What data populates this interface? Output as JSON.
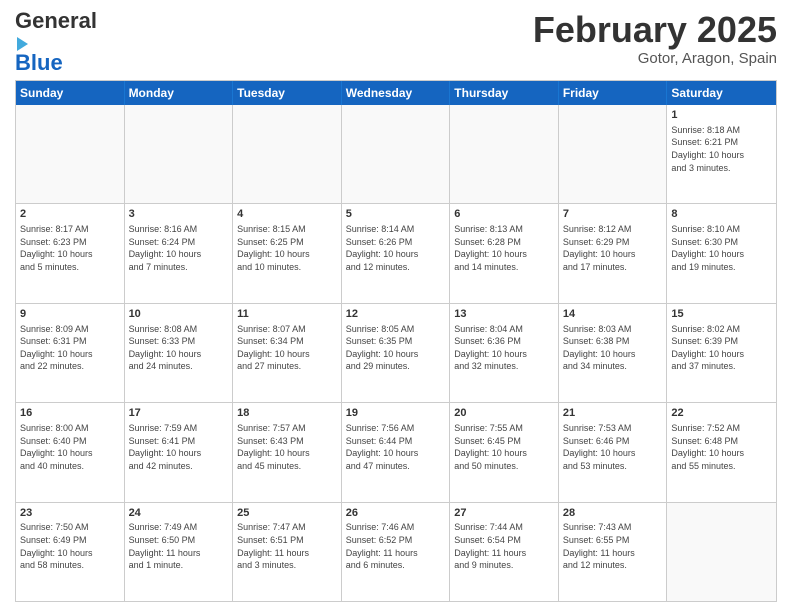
{
  "logo": {
    "line1": "General",
    "line2": "Blue"
  },
  "title": "February 2025",
  "subtitle": "Gotor, Aragon, Spain",
  "weekdays": [
    "Sunday",
    "Monday",
    "Tuesday",
    "Wednesday",
    "Thursday",
    "Friday",
    "Saturday"
  ],
  "rows": [
    [
      {
        "day": "",
        "info": ""
      },
      {
        "day": "",
        "info": ""
      },
      {
        "day": "",
        "info": ""
      },
      {
        "day": "",
        "info": ""
      },
      {
        "day": "",
        "info": ""
      },
      {
        "day": "",
        "info": ""
      },
      {
        "day": "1",
        "info": "Sunrise: 8:18 AM\nSunset: 6:21 PM\nDaylight: 10 hours\nand 3 minutes."
      }
    ],
    [
      {
        "day": "2",
        "info": "Sunrise: 8:17 AM\nSunset: 6:23 PM\nDaylight: 10 hours\nand 5 minutes."
      },
      {
        "day": "3",
        "info": "Sunrise: 8:16 AM\nSunset: 6:24 PM\nDaylight: 10 hours\nand 7 minutes."
      },
      {
        "day": "4",
        "info": "Sunrise: 8:15 AM\nSunset: 6:25 PM\nDaylight: 10 hours\nand 10 minutes."
      },
      {
        "day": "5",
        "info": "Sunrise: 8:14 AM\nSunset: 6:26 PM\nDaylight: 10 hours\nand 12 minutes."
      },
      {
        "day": "6",
        "info": "Sunrise: 8:13 AM\nSunset: 6:28 PM\nDaylight: 10 hours\nand 14 minutes."
      },
      {
        "day": "7",
        "info": "Sunrise: 8:12 AM\nSunset: 6:29 PM\nDaylight: 10 hours\nand 17 minutes."
      },
      {
        "day": "8",
        "info": "Sunrise: 8:10 AM\nSunset: 6:30 PM\nDaylight: 10 hours\nand 19 minutes."
      }
    ],
    [
      {
        "day": "9",
        "info": "Sunrise: 8:09 AM\nSunset: 6:31 PM\nDaylight: 10 hours\nand 22 minutes."
      },
      {
        "day": "10",
        "info": "Sunrise: 8:08 AM\nSunset: 6:33 PM\nDaylight: 10 hours\nand 24 minutes."
      },
      {
        "day": "11",
        "info": "Sunrise: 8:07 AM\nSunset: 6:34 PM\nDaylight: 10 hours\nand 27 minutes."
      },
      {
        "day": "12",
        "info": "Sunrise: 8:05 AM\nSunset: 6:35 PM\nDaylight: 10 hours\nand 29 minutes."
      },
      {
        "day": "13",
        "info": "Sunrise: 8:04 AM\nSunset: 6:36 PM\nDaylight: 10 hours\nand 32 minutes."
      },
      {
        "day": "14",
        "info": "Sunrise: 8:03 AM\nSunset: 6:38 PM\nDaylight: 10 hours\nand 34 minutes."
      },
      {
        "day": "15",
        "info": "Sunrise: 8:02 AM\nSunset: 6:39 PM\nDaylight: 10 hours\nand 37 minutes."
      }
    ],
    [
      {
        "day": "16",
        "info": "Sunrise: 8:00 AM\nSunset: 6:40 PM\nDaylight: 10 hours\nand 40 minutes."
      },
      {
        "day": "17",
        "info": "Sunrise: 7:59 AM\nSunset: 6:41 PM\nDaylight: 10 hours\nand 42 minutes."
      },
      {
        "day": "18",
        "info": "Sunrise: 7:57 AM\nSunset: 6:43 PM\nDaylight: 10 hours\nand 45 minutes."
      },
      {
        "day": "19",
        "info": "Sunrise: 7:56 AM\nSunset: 6:44 PM\nDaylight: 10 hours\nand 47 minutes."
      },
      {
        "day": "20",
        "info": "Sunrise: 7:55 AM\nSunset: 6:45 PM\nDaylight: 10 hours\nand 50 minutes."
      },
      {
        "day": "21",
        "info": "Sunrise: 7:53 AM\nSunset: 6:46 PM\nDaylight: 10 hours\nand 53 minutes."
      },
      {
        "day": "22",
        "info": "Sunrise: 7:52 AM\nSunset: 6:48 PM\nDaylight: 10 hours\nand 55 minutes."
      }
    ],
    [
      {
        "day": "23",
        "info": "Sunrise: 7:50 AM\nSunset: 6:49 PM\nDaylight: 10 hours\nand 58 minutes."
      },
      {
        "day": "24",
        "info": "Sunrise: 7:49 AM\nSunset: 6:50 PM\nDaylight: 11 hours\nand 1 minute."
      },
      {
        "day": "25",
        "info": "Sunrise: 7:47 AM\nSunset: 6:51 PM\nDaylight: 11 hours\nand 3 minutes."
      },
      {
        "day": "26",
        "info": "Sunrise: 7:46 AM\nSunset: 6:52 PM\nDaylight: 11 hours\nand 6 minutes."
      },
      {
        "day": "27",
        "info": "Sunrise: 7:44 AM\nSunset: 6:54 PM\nDaylight: 11 hours\nand 9 minutes."
      },
      {
        "day": "28",
        "info": "Sunrise: 7:43 AM\nSunset: 6:55 PM\nDaylight: 11 hours\nand 12 minutes."
      },
      {
        "day": "",
        "info": ""
      }
    ]
  ]
}
